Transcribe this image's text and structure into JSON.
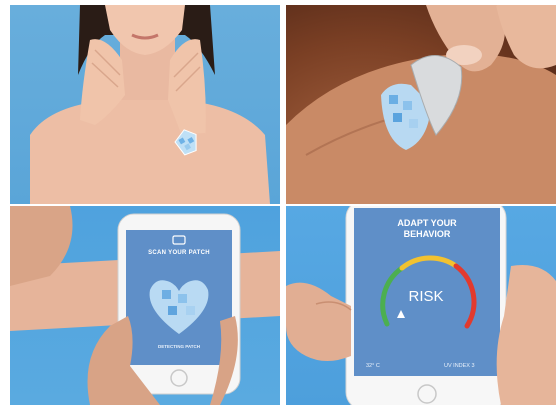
{
  "panels": {
    "scan": {
      "title": "SCAN YOUR PATCH",
      "footer": "DETECTING PATCH"
    },
    "adapt": {
      "title_line1": "ADAPT YOUR",
      "title_line2": "BEHAVIOR",
      "risk_label": "RISK",
      "temperature": "32° C",
      "uv_index": "UV INDEX 3"
    }
  },
  "colors": {
    "sky_blue": "#5aa5d8",
    "patch_blue": "#8fc3ea",
    "gauge_green": "#4caf50",
    "gauge_yellow": "#f2c230",
    "gauge_red": "#e23a2e",
    "phone_screen": "#5f8fc8"
  }
}
